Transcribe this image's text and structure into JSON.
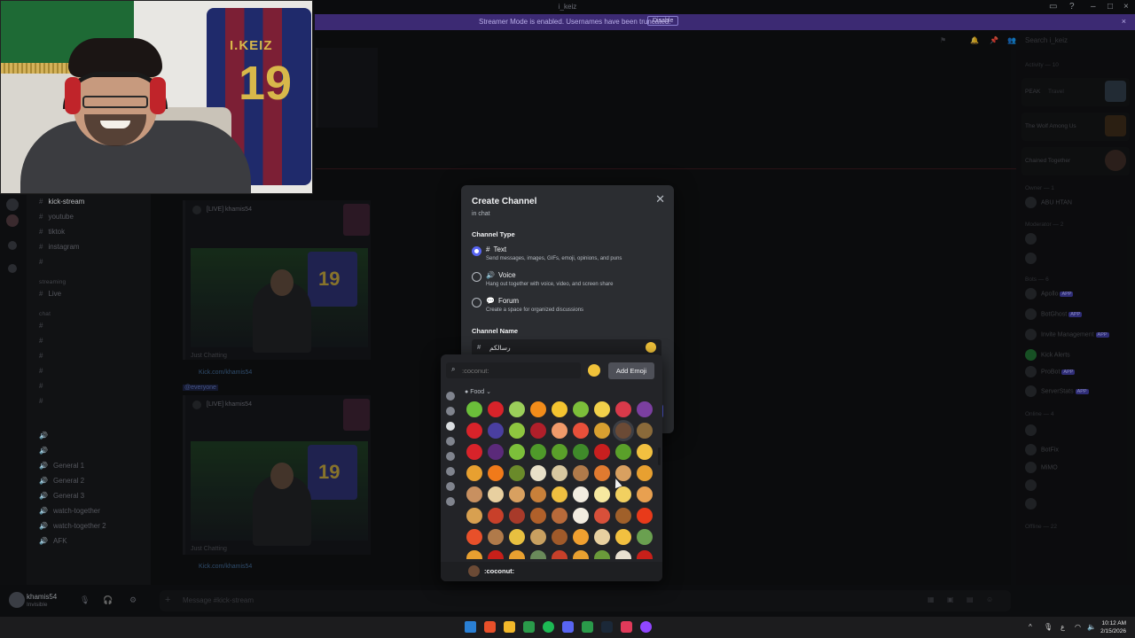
{
  "titlebar": {
    "title": "i_keiz"
  },
  "banner": {
    "text": "Streamer Mode is enabled. Usernames have been truncated.",
    "button": "Disable"
  },
  "webcam": {
    "jersey_name": "I.KEIZ",
    "jersey_number": "19"
  },
  "channels": {
    "items": [
      {
        "label": "kick-stream",
        "active": true
      },
      {
        "label": "youtube"
      },
      {
        "label": "tiktok"
      },
      {
        "label": "instagram"
      },
      {
        "label": ""
      }
    ],
    "category_streaming": "streaming",
    "live": "Live",
    "category_chat": "chat",
    "general": [
      "General 1",
      "General 2",
      "General 3"
    ],
    "watch": [
      "watch-together",
      "watch-together 2"
    ],
    "afk": "AFK"
  },
  "user": {
    "name": "khamis54",
    "status": "Invisible"
  },
  "feed": {
    "post1_title": "[LIVE] khamis54",
    "post1_category": "Just Chatting",
    "link1": "Kick.com/khamis54",
    "mention": "@everyone",
    "post2_title": "[LIVE] khamis54",
    "post2_category": "Just Chatting",
    "link2": "Kick.com/khamis54",
    "jersey_name": "I.KEIZ",
    "jersey_number": "19"
  },
  "composer": {
    "placeholder": "Message #kick-stream"
  },
  "members": {
    "search_placeholder": "Search i_keiz",
    "activity_header": "Activity — 10",
    "activities": [
      {
        "title": "PEAK",
        "sub": "Travel"
      },
      {
        "title": "The Wolf Among Us",
        "sub": ""
      },
      {
        "title": "Chained Together",
        "sub": ""
      }
    ],
    "owner_header": "Owner — 1",
    "owner": "ABU HTAN",
    "moderator_header": "Moderator — 2",
    "bots_header": "Bots — 6",
    "bots": [
      "Apollo",
      "BotGhost",
      "Invite Management",
      "Kick Alerts",
      "ProBot",
      "ServerStats"
    ],
    "bot_tag": "APP",
    "online_header": "Online — 4",
    "online": [
      "",
      "BotFix",
      "MiMO",
      "",
      ""
    ],
    "offline_header": "Offline — 22"
  },
  "modal": {
    "title": "Create Channel",
    "subtitle": "in chat",
    "type_label": "Channel Type",
    "options": [
      {
        "name": "Text",
        "desc": "Send messages, images, GIFs, emoji, opinions, and puns",
        "selected": true
      },
      {
        "name": "Voice",
        "desc": "Hang out together with voice, video, and screen share",
        "selected": false
      },
      {
        "name": "Forum",
        "desc": "Create a space for organized discussions",
        "selected": false
      }
    ],
    "name_label": "Channel Name",
    "name_value": "رسالكم"
  },
  "picker": {
    "search_placeholder": ":coconut:",
    "add_emoji": "Add Emoji",
    "section": "Food",
    "footer_name": ":coconut:",
    "grid": [
      [
        "#6bbf3a",
        "#d8232a",
        "#9bcf5a",
        "#f28c1a",
        "#f4c430",
        "#7cbf3a",
        "#f1d04a",
        "#d83a4a",
        "#7b3fa0"
      ],
      [
        "#d8232a",
        "#4a3fa0",
        "#8ec63f",
        "#b01f2a",
        "#f09a6a",
        "#e8503a",
        "#d8a030",
        "#6b4a35",
        "#8a6a3a"
      ],
      [
        "#d8232a",
        "#5b2a7a",
        "#7cbf3a",
        "#4f9a2a",
        "#5aa02a",
        "#3f8a2a",
        "#c81f1f",
        "#5aa02a",
        "#f2c040"
      ],
      [
        "#e8a030",
        "#f07a1a",
        "#6a8a2a",
        "#e8e0c8",
        "#d8c8a0",
        "#b07a4a",
        "#e07a30",
        "#d8a060",
        "#e8a030"
      ],
      [
        "#c89060",
        "#e8d0a0",
        "#d8a060",
        "#c8803a",
        "#f0c040",
        "#f2ece0",
        "#f6e8a0",
        "#f2d060",
        "#e8a050"
      ],
      [
        "#d8a050",
        "#c8402a",
        "#a83a2a",
        "#b0602a",
        "#b86a3a",
        "#f2ece0",
        "#d8503a",
        "#a0602a",
        "#e83a1a"
      ],
      [
        "#e8502a",
        "#b07a4a",
        "#e8c040",
        "#c8a060",
        "#a05a2a",
        "#f0a030",
        "#e8d0a0",
        "#f2c040",
        "#6aa050"
      ],
      [
        "#e8a030",
        "#c8201a",
        "#e8a030",
        "#6a8a5a",
        "#c8402a",
        "#e8a030",
        "#6a9a3a",
        "#e8e0d0",
        "#c8201a"
      ]
    ],
    "hover": [
      1,
      7
    ]
  },
  "taskbar": {
    "time": "10:12 AM",
    "date": "2/15/2026",
    "apps": [
      "#2a7fd4",
      "#e8502a",
      "#f2b82a",
      "#2a9a4a",
      "#1db954",
      "#5865f2",
      "#2a9a4a",
      "#1b2838",
      "#e03a5a",
      "#9146ff"
    ]
  },
  "colors": {
    "accent": "#5865f2",
    "banner": "#3c2a73",
    "modal_bg": "#2b2d31"
  }
}
